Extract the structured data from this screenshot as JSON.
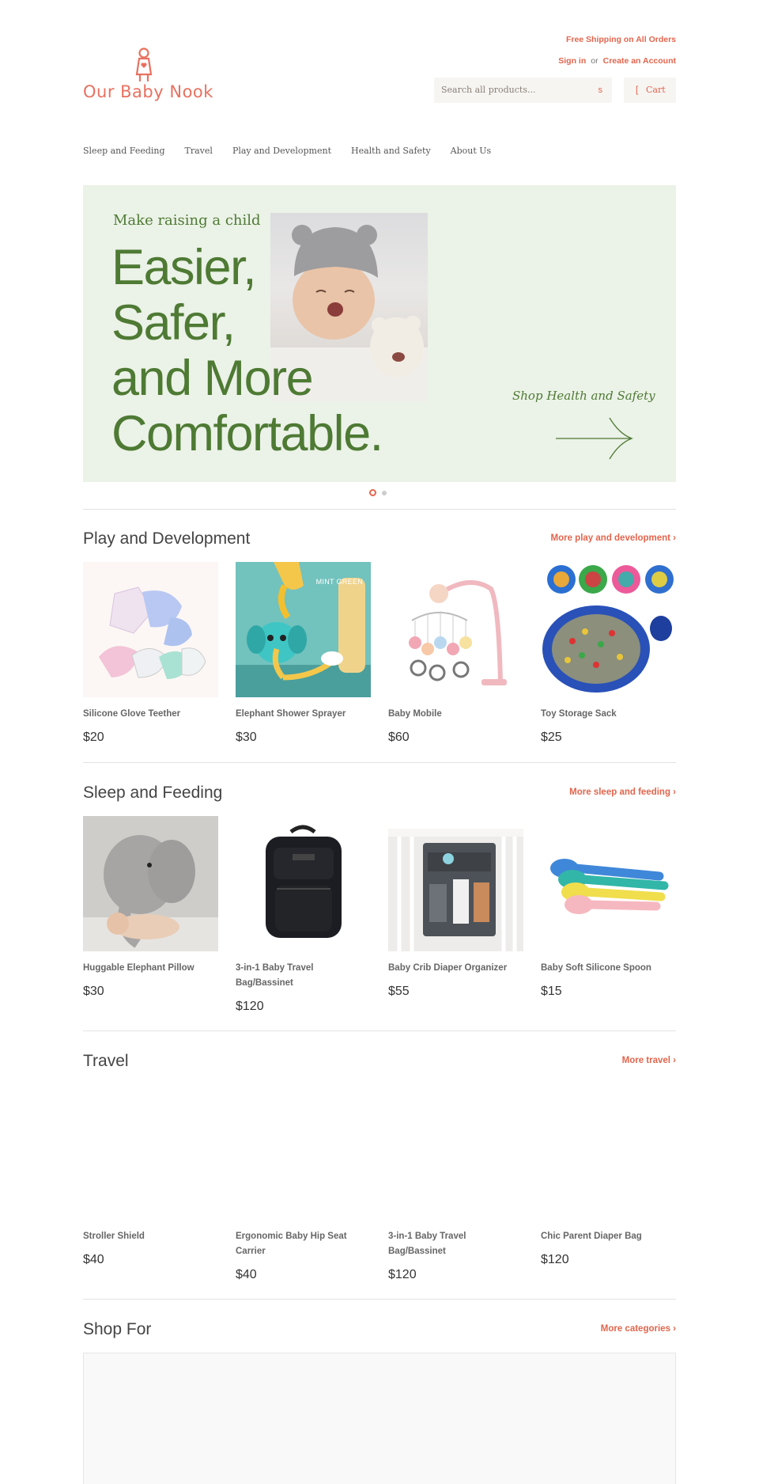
{
  "header": {
    "brand": "Our Baby Nook",
    "shipping_notice": "Free Shipping on All Orders",
    "sign_in": "Sign in",
    "or": "or",
    "create_account": "Create an Account",
    "search": {
      "placeholder": "Search all products...",
      "button_glyph": "s"
    },
    "cart": {
      "icon_glyph": "[",
      "label": "Cart"
    }
  },
  "nav": {
    "items": [
      {
        "label": "Sleep and Feeding"
      },
      {
        "label": "Travel"
      },
      {
        "label": "Play and Development"
      },
      {
        "label": "Health and Safety"
      },
      {
        "label": "About Us"
      }
    ]
  },
  "hero": {
    "kicker": "Make raising a child",
    "lines": [
      "Easier,",
      "Safer,",
      "and More",
      "Comfortable."
    ],
    "cta": "Shop Health and Safety",
    "slides_total": 2,
    "active_slide": 1
  },
  "sections": [
    {
      "title": "Play and Development",
      "more": "More play and development ›",
      "products": [
        {
          "name": "Silicone Glove Teether",
          "price": "$20",
          "image": "teether-gloves"
        },
        {
          "name": "Elephant Shower Sprayer",
          "price": "$30",
          "image": "elephant-sprayer",
          "badge": "MINT GREEN"
        },
        {
          "name": "Baby Mobile",
          "price": "$60",
          "image": "baby-mobile"
        },
        {
          "name": "Toy Storage Sack",
          "price": "$25",
          "image": "storage-sack"
        }
      ]
    },
    {
      "title": "Sleep and Feeding",
      "more": "More sleep and feeding ›",
      "products": [
        {
          "name": "Huggable Elephant Pillow",
          "price": "$30",
          "image": "elephant-pillow"
        },
        {
          "name": "3-in-1 Baby Travel Bag/Bassinet",
          "price": "$120",
          "image": "travel-backpack"
        },
        {
          "name": "Baby Crib Diaper Organizer",
          "price": "$55",
          "image": "diaper-organizer"
        },
        {
          "name": "Baby Soft Silicone Spoon",
          "price": "$15",
          "image": "silicone-spoons"
        }
      ]
    },
    {
      "title": "Travel",
      "more": "More travel ›",
      "products": [
        {
          "name": "Stroller Shield",
          "price": "$40"
        },
        {
          "name": "Ergonomic Baby Hip Seat Carrier",
          "price": "$40"
        },
        {
          "name": "3-in-1 Baby Travel Bag/Bassinet",
          "price": "$120"
        },
        {
          "name": "Chic Parent Diaper Bag",
          "price": "$120"
        }
      ]
    },
    {
      "title": "Shop For",
      "more": "More categories ›"
    }
  ],
  "colors": {
    "accent": "#e2654d",
    "hero_bg": "#ebf2e7",
    "hero_text": "#4e7a34"
  }
}
